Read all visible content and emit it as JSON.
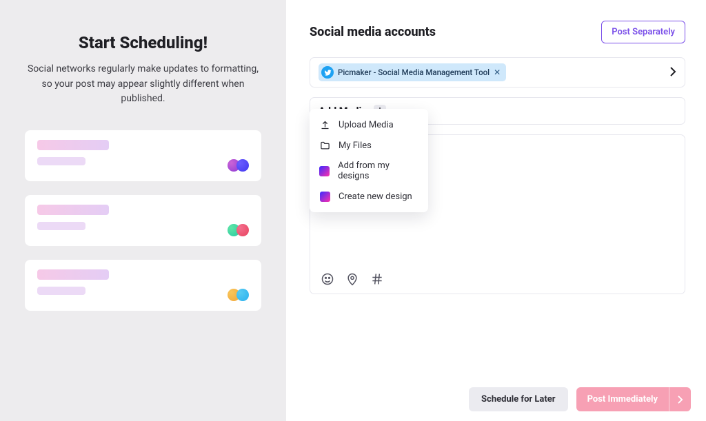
{
  "left": {
    "title": "Start Scheduling!",
    "subtitle": "Social networks regularly make updates to formatting, so your post may appear slightly different when published."
  },
  "right": {
    "title": "Social media accounts",
    "post_separately": "Post Separately",
    "account_chip": "Picmaker - Social Media Management Tool",
    "add_media": "Add Media"
  },
  "dropdown": {
    "upload": "Upload Media",
    "files": "My Files",
    "designs": "Add from my designs",
    "create": "Create new design"
  },
  "footer": {
    "later": "Schedule for Later",
    "post": "Post Immediately"
  }
}
